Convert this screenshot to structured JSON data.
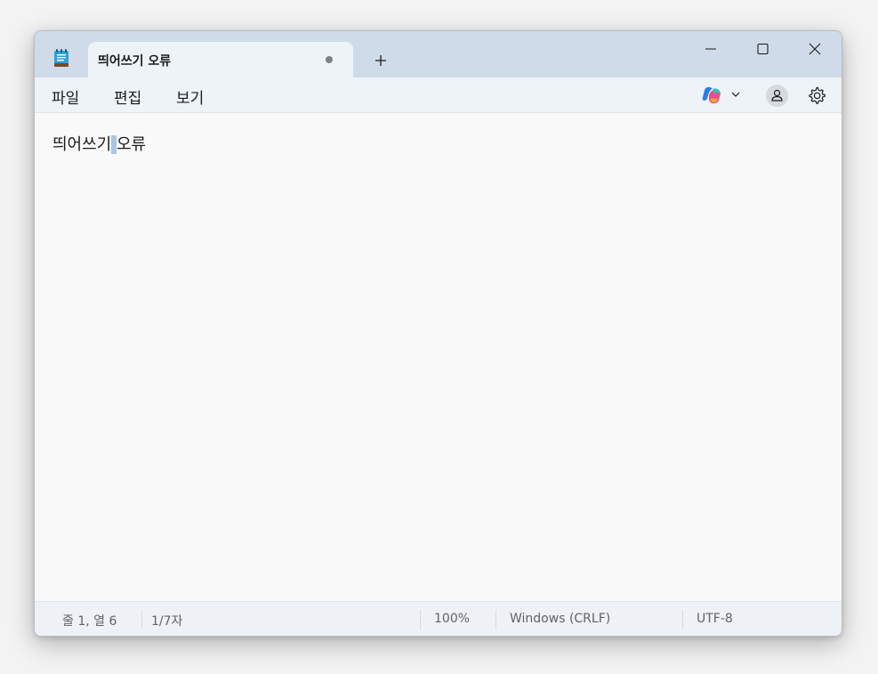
{
  "window": {
    "tab_title": "띄어쓰기 오류",
    "controls": {
      "minimize": "minimize-icon",
      "maximize": "maximize-icon",
      "close": "close-icon"
    }
  },
  "menu": {
    "file": "파일",
    "edit": "편집",
    "view": "보기"
  },
  "toolbar": {
    "copilot_icon": "copilot-icon",
    "account_icon": "account-icon",
    "settings_icon": "gear-icon"
  },
  "editor": {
    "text_before": "띄어쓰기",
    "selected": " ",
    "text_after": "오류"
  },
  "status": {
    "position": "줄 1, 열 6",
    "characters": "1/7자",
    "zoom": "100%",
    "line_ending": "Windows (CRLF)",
    "encoding": "UTF-8"
  },
  "colors": {
    "titlebar": "#cfdbe8",
    "tab": "#eef3f8",
    "selection": "#a9c6e2"
  }
}
